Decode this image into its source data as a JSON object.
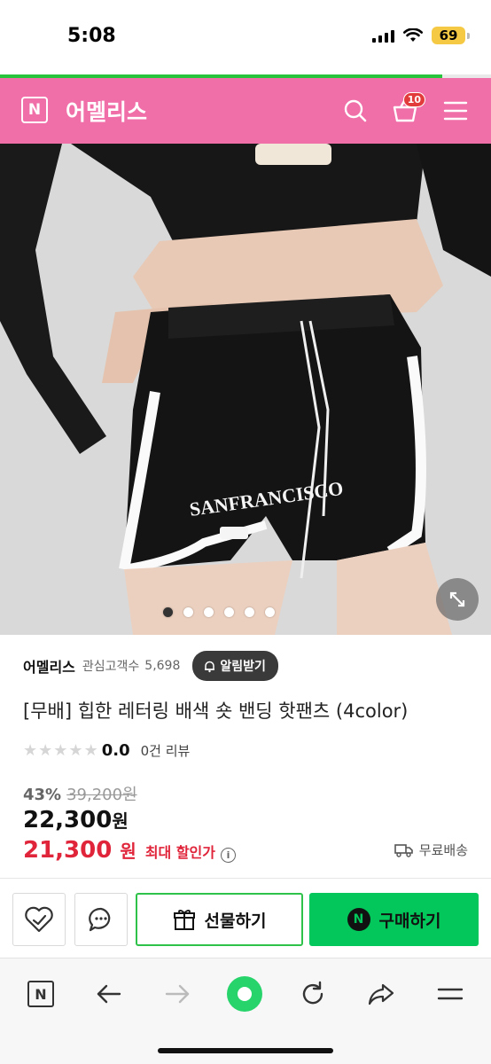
{
  "status_bar": {
    "time": "5:08",
    "battery": "69"
  },
  "header": {
    "logo_letter": "N",
    "store_name": "어멜리스",
    "cart_count": "10"
  },
  "gallery": {
    "image_description_icon": "product-photo"
  },
  "seller": {
    "name": "어멜리스",
    "follower_label": "관심고객수",
    "follower_count": "5,698",
    "notify_label": "알림받기"
  },
  "product": {
    "title": "[무배] 힙한 레터링 배색 숏 밴딩 핫팬츠 (4color)",
    "rating": "0.0",
    "review_count": "0건 리뷰",
    "discount_pct": "43%",
    "original_price": "39,200원",
    "sale_price_value": "22,300",
    "sale_price_unit": "원",
    "max_price_value": "21,300",
    "max_price_unit": "원",
    "max_discount_label": "최대 할인가",
    "info_glyph": "i",
    "shipping": "무료배송"
  },
  "actions": {
    "gift_label": "선물하기",
    "buy_label": "구매하기",
    "buy_logo": "N"
  },
  "bottom_nav": {
    "home_letter": "N"
  },
  "colors": {
    "header_bg": "#f06fa8",
    "buy_green": "#03c75a",
    "price_red": "#e0243a"
  },
  "progress": 0.9
}
